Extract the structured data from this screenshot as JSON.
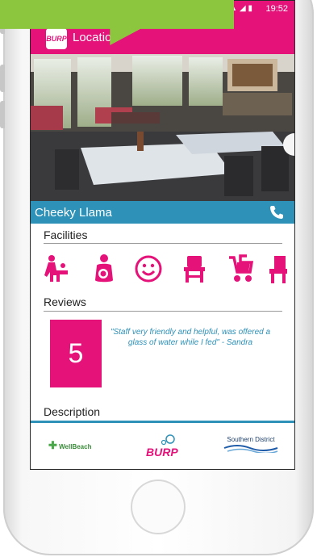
{
  "status_bar": {
    "time": "19:52"
  },
  "app_bar": {
    "logo": "BURP",
    "title": "Location"
  },
  "venue": {
    "name": "Cheeky Llama"
  },
  "facilities": {
    "title": "Facilities",
    "icons": [
      "baby-changing-icon",
      "breastfeeding-icon",
      "smiley-icon",
      "highchair-icon",
      "stroller-icon",
      "seat-icon"
    ]
  },
  "reviews": {
    "title": "Reviews",
    "score": "5",
    "quote": "\"Staff very friendly and helpful, was offered a glass of water while I fed\" - Sandra"
  },
  "description": {
    "title": "Description"
  },
  "footer": {
    "logos": [
      "WellBeach",
      "BURP",
      "Southern District"
    ]
  },
  "colors": {
    "brand": "#e5127a",
    "accent": "#2e91b8",
    "callout": "#8cc63f"
  }
}
